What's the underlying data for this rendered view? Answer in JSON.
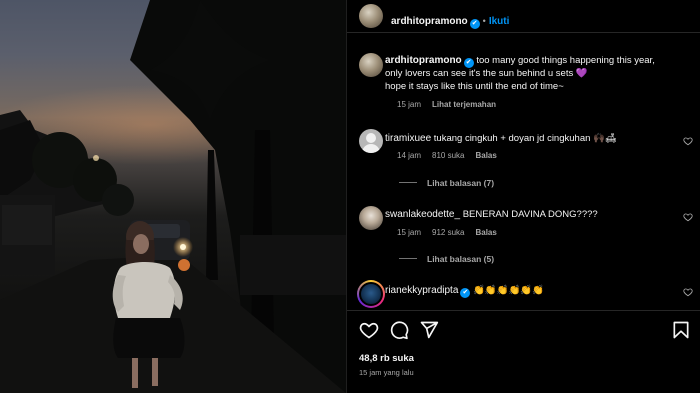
{
  "post": {
    "author": "ardhitopramono",
    "follow_label": "Ikuti",
    "dot": "•",
    "verified_icon": "✔"
  },
  "caption": {
    "username": "ardhitopramono",
    "text_line1": "too many good things happening this year,",
    "text_line2": "only lovers can see it's the sun behind u sets",
    "heart_emoji": "💜",
    "text_line3": "hope it stays like this until the end of time~",
    "time": "15 jam",
    "translate": "Lihat terjemahan"
  },
  "comments": [
    {
      "username": "tiramixuee",
      "text": "tukang cingkuh + doyan jd cingkuhan 🙌🏿🛋",
      "time": "14 jam",
      "likes": "810 suka",
      "reply": "Balas",
      "replies_label": "Lihat balasan (7)"
    },
    {
      "username": "swanlakeodette_",
      "text": "BENERAN DAVINA DONG????",
      "time": "15 jam",
      "likes": "912 suka",
      "reply": "Balas",
      "replies_label": "Lihat balasan (5)"
    },
    {
      "username": "rianekkypradipta",
      "text": "👏👏👏👏👏👏"
    }
  ],
  "footer": {
    "likes": "48,8 rb suka",
    "time": "15 jam yang lalu"
  },
  "colors": {
    "accent": "#0095f6",
    "muted": "#a8a8a8",
    "background": "#000000"
  }
}
